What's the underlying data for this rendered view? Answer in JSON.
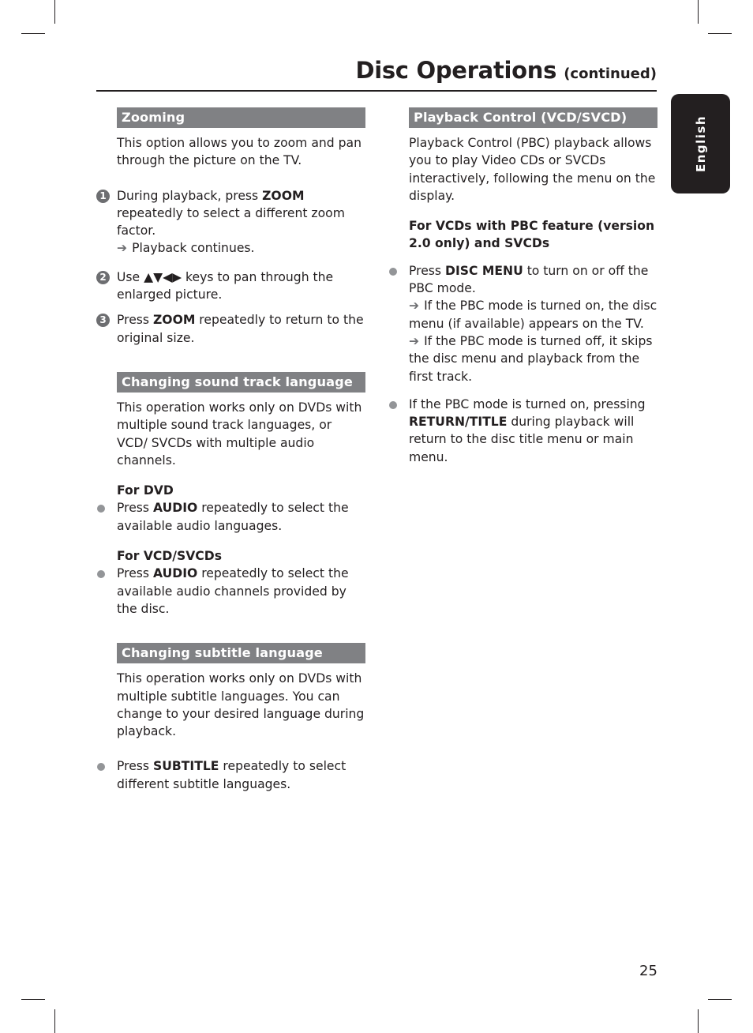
{
  "header": {
    "title": "Disc Operations",
    "title_suffix": "(continued)"
  },
  "side_tab": {
    "label": "English"
  },
  "left_column": {
    "zooming": {
      "heading": "Zooming",
      "intro": "This option allows you to zoom and pan through the picture on the TV.",
      "steps": [
        {
          "number": "1",
          "pre": "During playback, press ",
          "key": "ZOOM",
          "post": " repeatedly to select a different zoom factor.",
          "result": "Playback continues."
        },
        {
          "number": "2",
          "pre": "Use ",
          "key": "▲▼◀▶",
          "post": " keys to pan through the enlarged picture."
        },
        {
          "number": "3",
          "pre": "Press ",
          "key": "ZOOM",
          "post": " repeatedly to return to the original size."
        }
      ]
    },
    "sound_track": {
      "heading": "Changing sound track language",
      "intro": "This operation works only on DVDs with multiple sound track languages, or VCD/ SVCDs with multiple audio channels.",
      "groups": [
        {
          "subheading": "For DVD",
          "pre": "Press ",
          "key": "AUDIO",
          "post": " repeatedly to select the available audio languages."
        },
        {
          "subheading": "For VCD/SVCDs",
          "pre": "Press ",
          "key": "AUDIO",
          "post": " repeatedly to select the available audio channels provided by the disc."
        }
      ]
    },
    "subtitle": {
      "heading": "Changing subtitle language",
      "intro": "This operation works only on DVDs with multiple subtitle languages. You can change to your desired language during playback.",
      "bullet": {
        "pre": "Press ",
        "key": "SUBTITLE",
        "post": " repeatedly to select different subtitle languages."
      }
    }
  },
  "right_column": {
    "pbc": {
      "heading": "Playback Control (VCD/SVCD)",
      "intro": "Playback Control (PBC) playback allows you to play Video CDs or SVCDs interactively, following the menu on the display.",
      "subheading": "For VCDs with PBC feature (version 2.0 only) and SVCDs",
      "bullets": [
        {
          "pre": "Press ",
          "key": "DISC MENU",
          "post": " to turn on or off the PBC mode.",
          "results": [
            "If the PBC mode is turned on, the disc menu (if available) appears on the TV.",
            "If the PBC mode is turned off, it skips the disc menu and playback from the first track."
          ]
        },
        {
          "pre": "If the PBC mode is turned on, pressing ",
          "key": "RETURN/TITLE",
          "post": " during playback will return to the disc title menu or main menu."
        }
      ]
    }
  },
  "footer": {
    "page_number": "25"
  },
  "icons": {
    "result_arrow": "➔"
  }
}
